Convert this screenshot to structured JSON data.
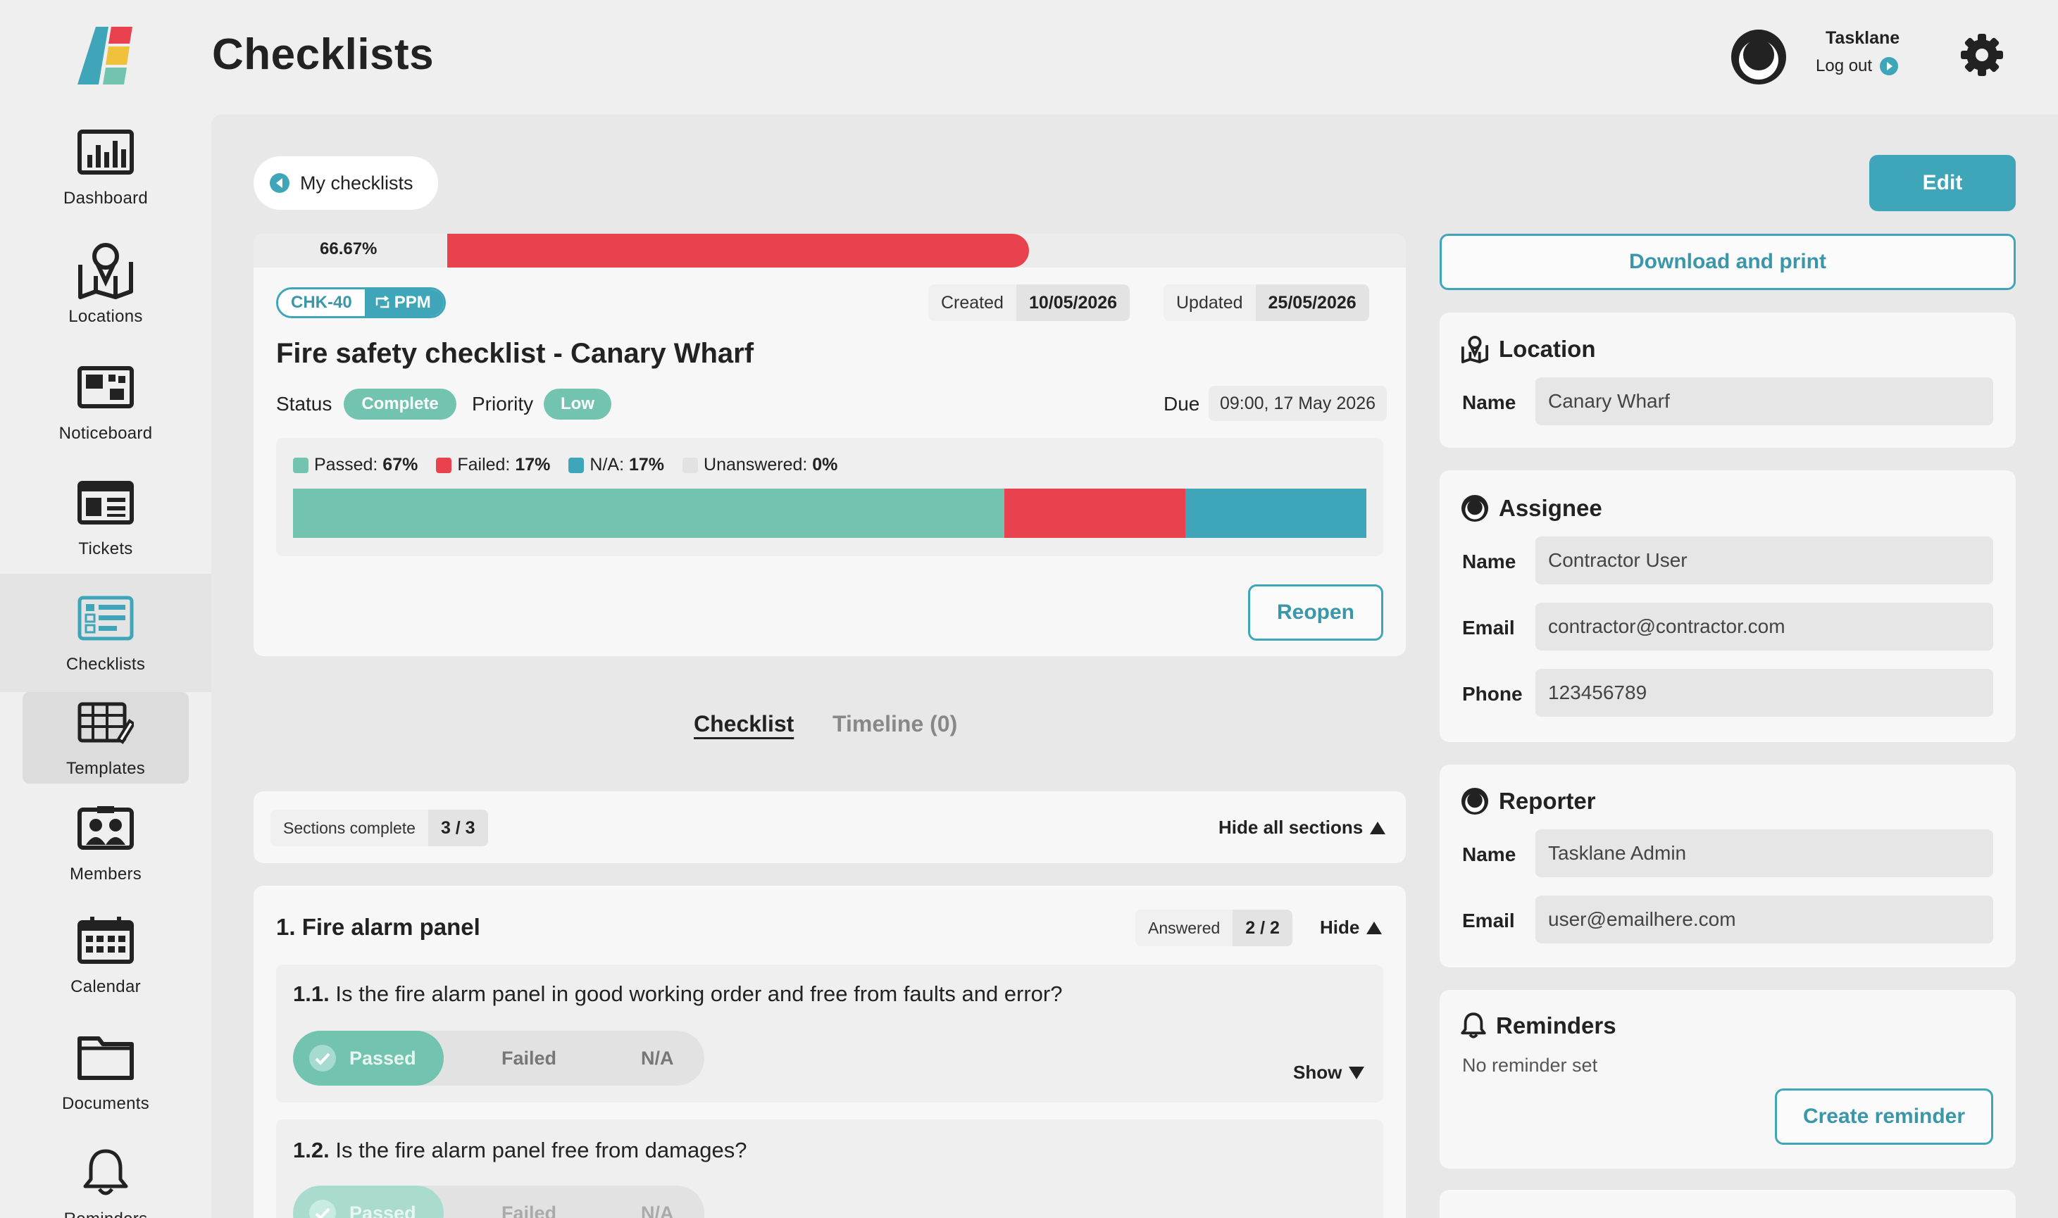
{
  "app": {
    "title": "Checklists"
  },
  "sidebar": {
    "items": [
      {
        "label": "Dashboard",
        "icon": "bar-chart-icon"
      },
      {
        "label": "Locations",
        "icon": "map-icon"
      },
      {
        "label": "Noticeboard",
        "icon": "noticeboard-icon"
      },
      {
        "label": "Tickets",
        "icon": "ticket-icon"
      },
      {
        "label": "Checklists",
        "icon": "checklist-icon"
      },
      {
        "label": "Templates",
        "icon": "template-icon"
      },
      {
        "label": "Members",
        "icon": "members-icon"
      },
      {
        "label": "Calendar",
        "icon": "calendar-icon"
      },
      {
        "label": "Documents",
        "icon": "folder-icon"
      },
      {
        "label": "Reminders",
        "icon": "bell-icon"
      }
    ]
  },
  "header": {
    "username": "Tasklane",
    "logout": "Log out"
  },
  "colors": {
    "accent": "#3fa6ba",
    "passed": "#72c4b0",
    "failed": "#e9424e",
    "na": "#3fa6ba",
    "unanswered": "#e2e2e2"
  },
  "back": {
    "label": "My checklists"
  },
  "actions": {
    "edit": "Edit",
    "download": "Download and print",
    "reopen": "Reopen",
    "create_reminder": "Create reminder"
  },
  "checklist": {
    "progress_label": "66.67%",
    "progress": 0.6667,
    "id": "CHK-40",
    "type": "PPM",
    "created_label": "Created",
    "created": "10/05/2026",
    "updated_label": "Updated",
    "updated": "25/05/2026",
    "title": "Fire safety checklist - Canary Wharf",
    "status_label": "Status",
    "status": "Complete",
    "priority_label": "Priority",
    "priority": "Low",
    "due_label": "Due",
    "due": "09:00, 17 May 2026",
    "breakdown": {
      "passed_label": "Passed:",
      "passed": "67%",
      "passed_value": 67,
      "failed_label": "Failed:",
      "failed": "17%",
      "failed_value": 17,
      "na_label": "N/A:",
      "na": "17%",
      "na_value": 17,
      "unanswered_label": "Unanswered:",
      "unanswered": "0%",
      "unanswered_value": 0
    }
  },
  "tabs": [
    {
      "label": "Checklist",
      "active": true
    },
    {
      "label": "Timeline (0)",
      "active": false
    }
  ],
  "sections_bar": {
    "label": "Sections complete",
    "value": "3 / 3",
    "hide_all": "Hide all sections"
  },
  "sections": [
    {
      "title": "1. Fire alarm panel",
      "answered_label": "Answered",
      "answered": "2 / 2",
      "hide": "Hide",
      "questions": [
        {
          "num": "1.1.",
          "text": "Is the fire alarm panel in good working order and free from faults and error?",
          "show": "Show"
        },
        {
          "num": "1.2.",
          "text": "Is the fire alarm panel free from damages?"
        }
      ]
    }
  ],
  "answer_options": {
    "passed": "Passed",
    "failed": "Failed",
    "na": "N/A"
  },
  "location": {
    "heading": "Location",
    "name_label": "Name",
    "name": "Canary Wharf"
  },
  "assignee": {
    "heading": "Assignee",
    "name_label": "Name",
    "name": "Contractor User",
    "email_label": "Email",
    "email": "contractor@contractor.com",
    "phone_label": "Phone",
    "phone": "123456789"
  },
  "reporter": {
    "heading": "Reporter",
    "name_label": "Name",
    "name": "Tasklane Admin",
    "email_label": "Email",
    "email": "user@emailhere.com"
  },
  "reminders": {
    "heading": "Reminders",
    "empty": "No reminder set"
  }
}
